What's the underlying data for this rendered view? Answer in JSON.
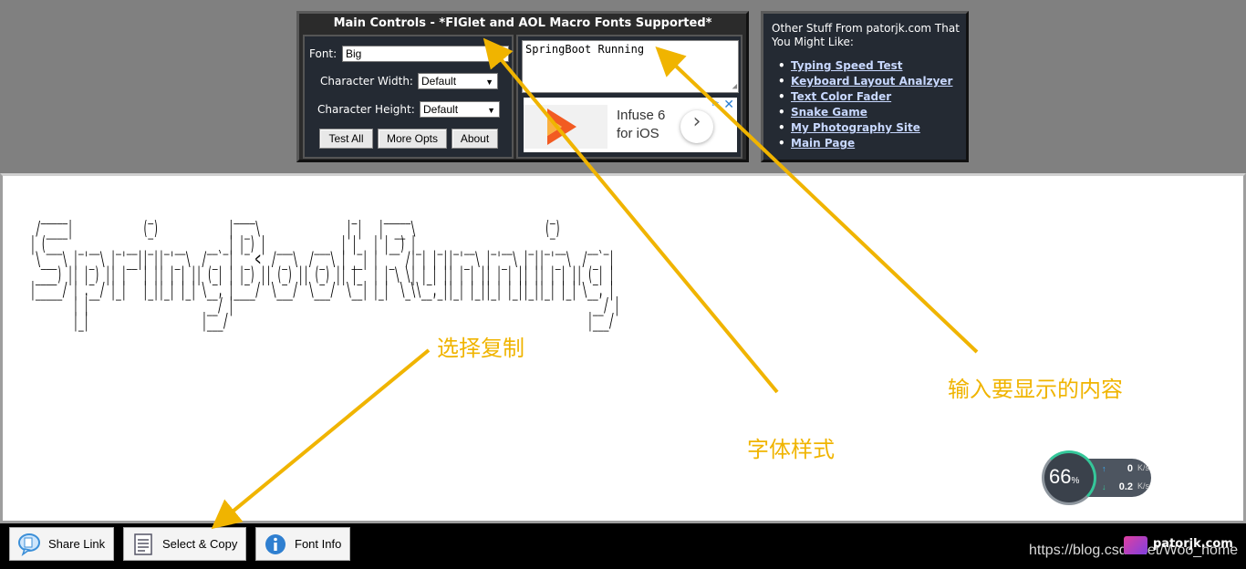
{
  "main_controls": {
    "title": "Main Controls - *FIGlet and AOL Macro Fonts Supported*",
    "font_label": "Font:",
    "font_value": "Big",
    "char_width_label": "Character Width:",
    "char_width_value": "Default",
    "char_height_label": "Character Height:",
    "char_height_value": "Default",
    "buttons": [
      "Test All",
      "More Opts",
      "About"
    ],
    "input_text": "SpringBoot Running"
  },
  "ad": {
    "line1": "Infuse 6",
    "line2": "for iOS",
    "next": "›",
    "close": "✕"
  },
  "other_stuff": {
    "heading": "Other Stuff From patorjk.com That You Might Like:",
    "links": [
      "Typing Speed Test",
      "Keyboard Layout Analzyer",
      "Text Color Fader",
      "Snake Game",
      "My Photography Site",
      "Main Page"
    ]
  },
  "output": {
    "ascii_art": "  _____               _               ____                  _     _____                          _               \n / ____|             (_)             |  _ \\                | |   |  __ \\                        (_)              \n| (___   _ __   _ __  _  _ __    __ _| |_) |  ___    ___  | |_  | |__) |_   _  _ __   _ __   _  _ __    __ _ \n \\___ \\ | '_ \\ | '__|| || '_ \\  / _` |  _ <  / _ \\  / _ \\ | __| |  _  /| | | || '_ \\ | '_ \\ | || '_ \\  / _` |\n ____) || |_) || |   | || | | || (_| | |_) || (_) || (_) || |_  | | \\ \\| |_| || | | || | | || || | | || (_| |\n|_____/ | .__/ |_|   |_||_| |_| \\__, |____/  \\___/  \\___/  \\__| |_|  \\_\\\\__,_||_| |_||_| |_||_||_| |_| \\__, |\n        | |                      __/ |                                                                   __/ |\n        |_|                     |___/                                                                   |___/ "
  },
  "annotations": {
    "select_copy": "选择复制",
    "font_style": "字体样式",
    "input_content": "输入要显示的内容",
    "color": "#f0b400"
  },
  "speed_widget": {
    "percent": "66",
    "percent_sign": "%",
    "up_value": "0",
    "up_unit": "K/s",
    "down_value": "0.2",
    "down_unit": "K/s"
  },
  "bottom_bar": {
    "share_link": "Share Link",
    "select_copy": "Select & Copy",
    "font_info": "Font Info",
    "site_name": "patorjk.com",
    "watermark": "https://blog.csdn.net/Woo_home"
  }
}
